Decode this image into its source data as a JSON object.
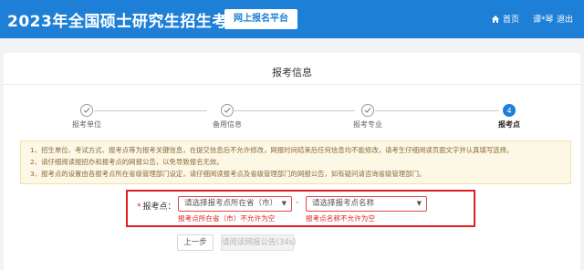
{
  "header": {
    "title": "2023年全国硕士研究生招生考试",
    "platform": "网上报名平台",
    "nav": {
      "home": "首页",
      "user": "谭*琴",
      "logout": "退出"
    }
  },
  "page_title": "报考信息",
  "steps": [
    {
      "label": "报考单位",
      "status": "done"
    },
    {
      "label": "备用信息",
      "status": "done"
    },
    {
      "label": "报考专业",
      "status": "done"
    },
    {
      "label": "报考点",
      "status": "active",
      "number": "4"
    }
  ],
  "notice": [
    "1、招生单位、考试方式、报考点等为报考关键信息，在提交信息后不允许修改，网报时间结束后任何信息均不能修改，请考生仔细阅读页面文字并认真填写选择。",
    "2、请仔细阅读报招办和报考点的网报公告，以免导致报名无效。",
    "3、报考点的设置由各报考点所在省级管理部门设定，请仔细阅读报考点及省级管理部门的网报公告，如有疑问请咨询省级管理部门。"
  ],
  "form": {
    "label": "报考点：",
    "required_mark": "*",
    "province_select": "请选择报考点所在省（市）",
    "site_select": "请选择报考点名称",
    "separator": "-",
    "province_error": "报考点所在省（市）不允许为空",
    "site_error": "报考点名称不允许为空"
  },
  "buttons": {
    "prev": "上一步",
    "read_notice": "请阅读网报公告(34s)"
  },
  "colors": {
    "brand": "#1e7fd6",
    "error": "#e02020",
    "notice_bg": "#fdf7e6"
  }
}
